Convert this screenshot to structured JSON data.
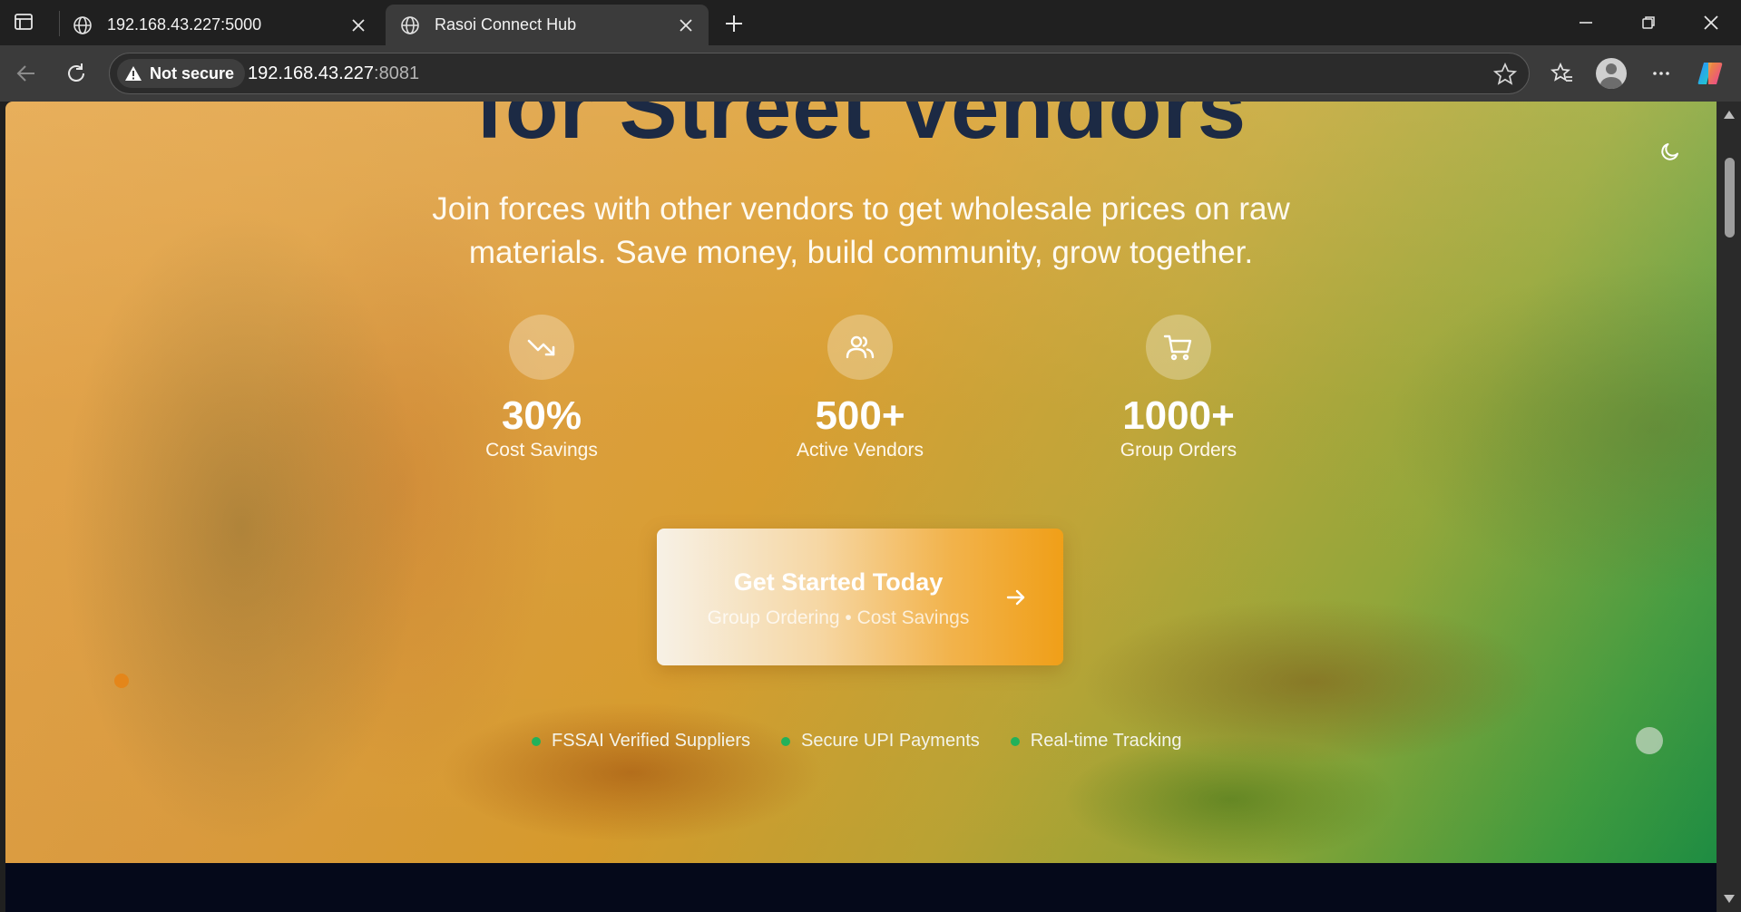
{
  "browser": {
    "tabs": [
      {
        "title": "192.168.43.227:5000",
        "active": false
      },
      {
        "title": "Rasoi Connect Hub",
        "active": true
      }
    ],
    "security_label": "Not secure",
    "url_host": "192.168.43.227",
    "url_port": ":8081"
  },
  "hero": {
    "headline": "for Street Vendors",
    "subtitle": "Join forces with other vendors to get wholesale prices on raw materials. Save money, build community, grow together.",
    "stats": [
      {
        "icon": "trending-down-icon",
        "value": "30%",
        "label": "Cost Savings"
      },
      {
        "icon": "users-icon",
        "value": "500+",
        "label": "Active Vendors"
      },
      {
        "icon": "cart-icon",
        "value": "1000+",
        "label": "Group Orders"
      }
    ],
    "cta": {
      "title": "Get Started Today",
      "subtitle": "Group Ordering • Cost Savings"
    },
    "badges": [
      "FSSAI Verified Suppliers",
      "Secure UPI Payments",
      "Real-time Tracking"
    ]
  },
  "colors": {
    "headline": "#1c2a44",
    "cta_start": "#f7f1e6",
    "cta_end": "#f09f18",
    "badge_dot": "#22b15a",
    "footer_band": "#05091a"
  }
}
